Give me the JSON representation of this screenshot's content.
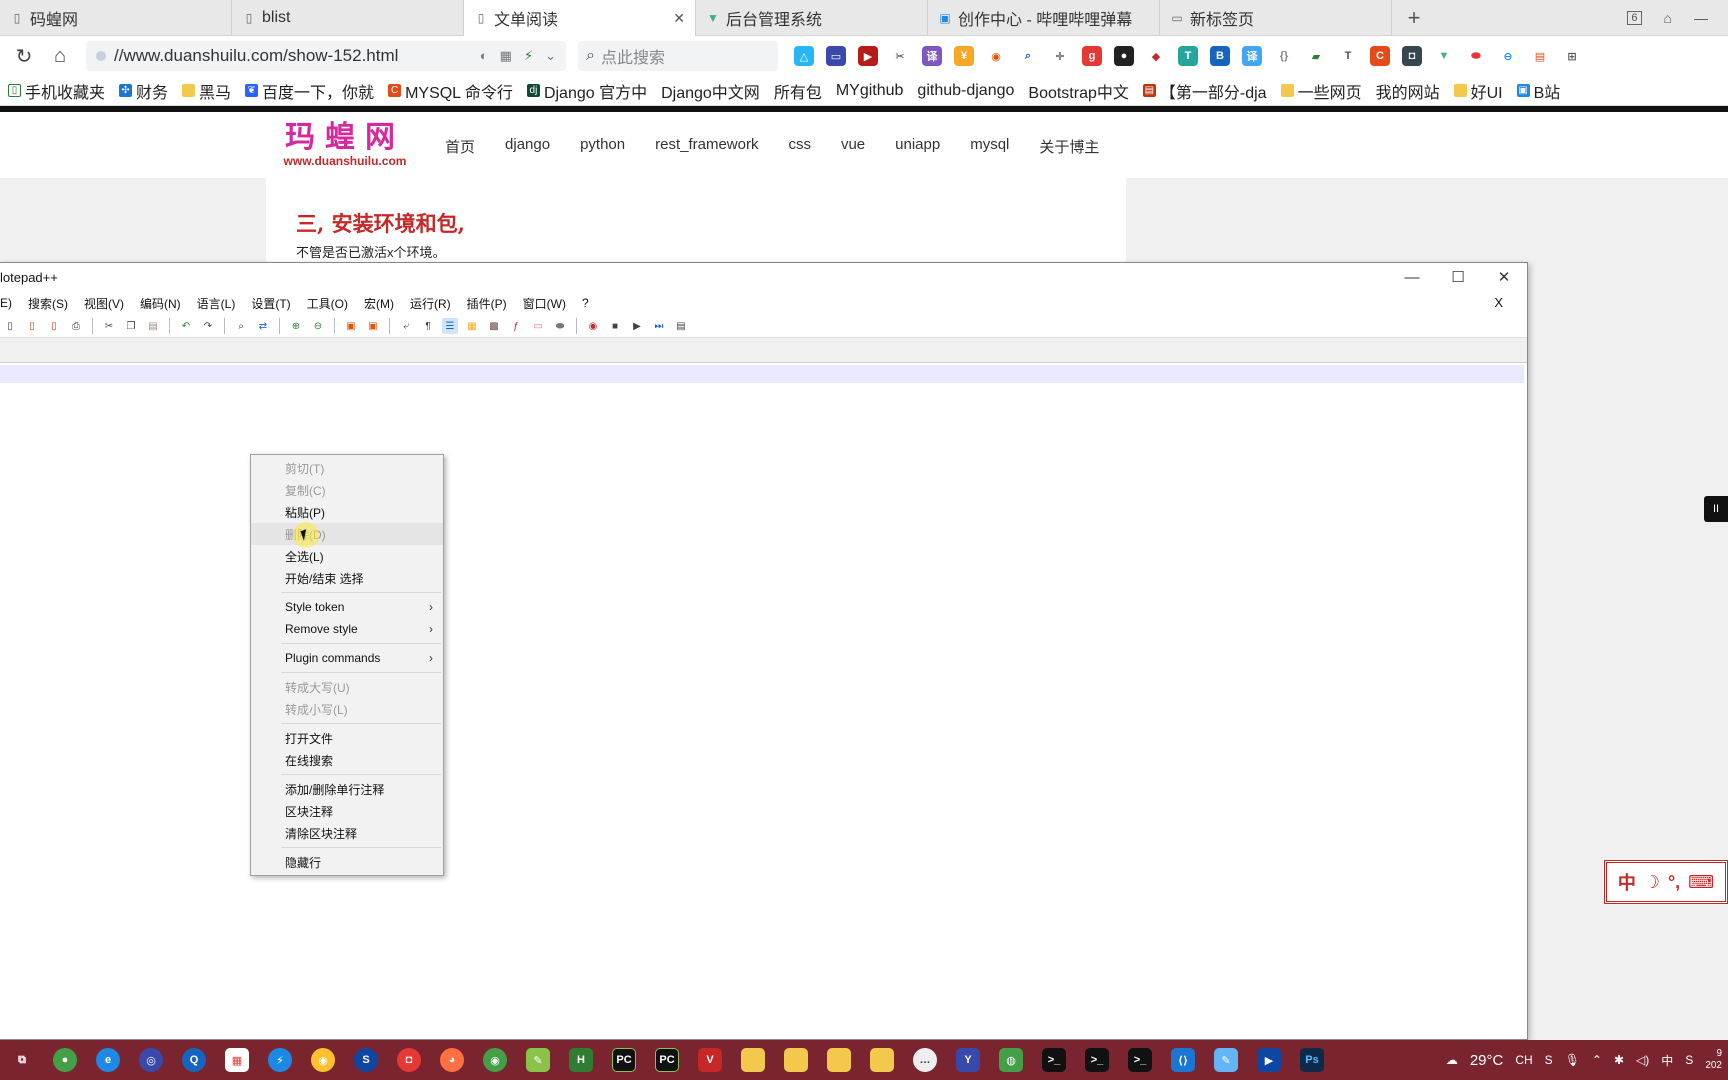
{
  "browser": {
    "tabs": [
      {
        "label": "码蝗网",
        "icon": "page-icon",
        "active": false
      },
      {
        "label": "blist",
        "icon": "page-icon",
        "active": false
      },
      {
        "label": "文单阅读",
        "icon": "page-icon",
        "active": true
      },
      {
        "label": "后台管理系统",
        "icon": "vue-icon",
        "active": false
      },
      {
        "label": "创作中心 - 哔哩哔哩弹幕",
        "icon": "bilibili-icon",
        "active": false
      },
      {
        "label": "新标签页",
        "icon": "newtab-icon",
        "active": false
      }
    ],
    "tab_count": "6",
    "url": "//www.duanshuilu.com/show-152.html",
    "search_placeholder": "点此搜索",
    "bookmarks": [
      {
        "label": "手机收藏夹",
        "icon": "phone-icon"
      },
      {
        "label": "财务",
        "icon": "finance-icon"
      },
      {
        "label": "黑马",
        "icon": "folder-icon"
      },
      {
        "label": "百度一下，你就",
        "icon": "baidu-icon"
      },
      {
        "label": "MYSQL 命令行",
        "icon": "page-icon"
      },
      {
        "label": "Django 官方中",
        "icon": "django-icon"
      },
      {
        "label": "Django中文网",
        "icon": "page-icon"
      },
      {
        "label": "所有包",
        "icon": "page-icon"
      },
      {
        "label": "MYgithub",
        "icon": "page-icon"
      },
      {
        "label": "github-django",
        "icon": "page-icon"
      },
      {
        "label": "Bootstrap中文",
        "icon": "page-icon"
      },
      {
        "label": "【第一部分-dja",
        "icon": "page-icon"
      },
      {
        "label": "一些网页",
        "icon": "folder-icon"
      },
      {
        "label": "我的网站",
        "icon": "page-icon"
      },
      {
        "label": "好UI",
        "icon": "folder-icon"
      },
      {
        "label": "B站",
        "icon": "bilibili-icon"
      }
    ]
  },
  "site": {
    "logo_title": "玛蝗网",
    "logo_url": "www.duanshuilu.com",
    "nav": [
      "首页",
      "django",
      "python",
      "rest_framework",
      "css",
      "vue",
      "uniapp",
      "mysql",
      "关于博主"
    ],
    "heading": "三, 安装环境和包,",
    "paragraph": "不管是否已激活x个环境。"
  },
  "notepad": {
    "title": "lotepad++",
    "menu": [
      "E)",
      "搜索(S)",
      "视图(V)",
      "编码(N)",
      "语言(L)",
      "设置(T)",
      "工具(O)",
      "宏(M)",
      "运行(R)",
      "插件(P)",
      "窗口(W)",
      "?"
    ],
    "close_doc": "X",
    "context_menu": [
      {
        "label": "剪切(T)",
        "disabled": true
      },
      {
        "label": "复制(C)",
        "disabled": true
      },
      {
        "label": "粘贴(P)",
        "disabled": false
      },
      {
        "label": "删除(D)",
        "disabled": true,
        "hover": true
      },
      {
        "label": "全选(L)",
        "disabled": false
      },
      {
        "label": "开始/结束 选择",
        "disabled": false
      },
      {
        "sep": true
      },
      {
        "label": "Style token",
        "disabled": false,
        "submenu": true
      },
      {
        "label": "Remove style",
        "disabled": false,
        "submenu": true
      },
      {
        "sep": true
      },
      {
        "label": "Plugin commands",
        "disabled": false,
        "submenu": true
      },
      {
        "sep": true
      },
      {
        "label": "转成大写(U)",
        "disabled": true
      },
      {
        "label": "转成小写(L)",
        "disabled": true
      },
      {
        "sep": true
      },
      {
        "label": "打开文件",
        "disabled": false
      },
      {
        "label": "在线搜索",
        "disabled": false
      },
      {
        "sep": true
      },
      {
        "label": "添加/删除单行注释",
        "disabled": false
      },
      {
        "label": "区块注释",
        "disabled": false
      },
      {
        "label": "清除区块注释",
        "disabled": false
      },
      {
        "sep": true
      },
      {
        "label": "隐藏行",
        "disabled": false
      }
    ]
  },
  "ime": {
    "label": "中",
    "mode": "☽",
    "punct": "°,"
  },
  "side_handle": "II",
  "taskbar": {
    "weather": "29°C",
    "tray_lang": "中",
    "clock_line1": "9",
    "clock_line2": "202"
  },
  "colors": {
    "brand_pink": "#d6289f",
    "heading_red": "#c62828",
    "taskbar": "#7a2430",
    "current_line": "#e8e8ff"
  }
}
